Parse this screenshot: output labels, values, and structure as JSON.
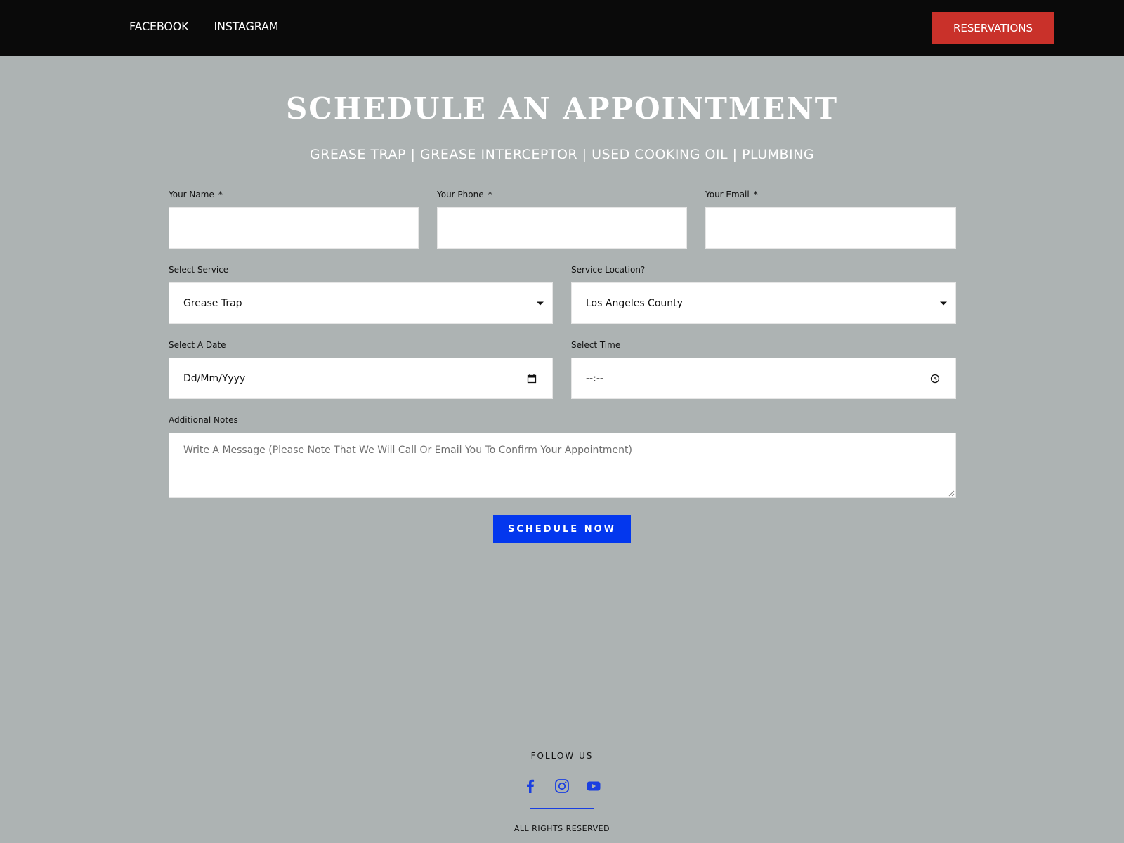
{
  "topbar": {
    "nav": [
      "FACEBOOK",
      "INSTAGRAM"
    ],
    "reservations_label": "RESERVATIONS"
  },
  "heading": {
    "title": "SCHEDULE AN APPOINTMENT",
    "subtitle": "GREASE TRAP | GREASE INTERCEPTOR | USED COOKING OIL | PLUMBING"
  },
  "form": {
    "name": {
      "label": "Your Name",
      "required_mark": "*",
      "value": ""
    },
    "phone": {
      "label": "Your Phone",
      "required_mark": "*",
      "value": ""
    },
    "email": {
      "label": "Your Email",
      "required_mark": "*",
      "value": ""
    },
    "service": {
      "label": "Select Service",
      "value": "Grease Trap"
    },
    "location": {
      "label": "Service Location?",
      "value": "Los Angeles County"
    },
    "date": {
      "label": "Select A Date",
      "placeholder": "Dd/Mm/Yyyy"
    },
    "time": {
      "label": "Select Time",
      "placeholder": "--:--"
    },
    "notes": {
      "label": "Additional Notes",
      "placeholder": "Write A Message (Please Note That We Will Call Or Email You To Confirm Your Appointment)"
    },
    "submit_label": "SCHEDULE NOW"
  },
  "footer": {
    "follow_label": "FOLLOW US",
    "social_icons": [
      "facebook-icon",
      "instagram-icon",
      "youtube-icon"
    ],
    "rights": "ALL RIGHTS RESERVED"
  },
  "colors": {
    "page_background": "#adb3b3",
    "topbar": "#0a0a0a",
    "reservations_button": "#c9312a",
    "primary_button": "#0337ee",
    "social_icons": "#1a3fe0"
  }
}
